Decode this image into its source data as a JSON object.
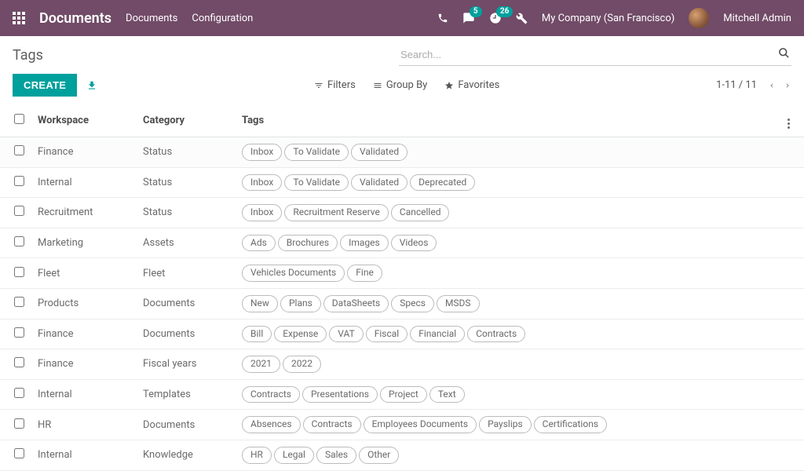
{
  "navbar": {
    "brand": "Documents",
    "links": [
      "Documents",
      "Configuration"
    ],
    "messages_badge": "5",
    "activities_badge": "26",
    "company": "My Company (San Francisco)",
    "username": "Mitchell Admin"
  },
  "breadcrumb": "Tags",
  "search": {
    "placeholder": "Search..."
  },
  "buttons": {
    "create": "CREATE",
    "filters": "Filters",
    "group_by": "Group By",
    "favorites": "Favorites"
  },
  "pager": "1-11 / 11",
  "table": {
    "headers": {
      "workspace": "Workspace",
      "category": "Category",
      "tags": "Tags"
    },
    "rows": [
      {
        "workspace": "Finance",
        "category": "Status",
        "tags": [
          "Inbox",
          "To Validate",
          "Validated"
        ]
      },
      {
        "workspace": "Internal",
        "category": "Status",
        "tags": [
          "Inbox",
          "To Validate",
          "Validated",
          "Deprecated"
        ]
      },
      {
        "workspace": "Recruitment",
        "category": "Status",
        "tags": [
          "Inbox",
          "Recruitment Reserve",
          "Cancelled"
        ]
      },
      {
        "workspace": "Marketing",
        "category": "Assets",
        "tags": [
          "Ads",
          "Brochures",
          "Images",
          "Videos"
        ]
      },
      {
        "workspace": "Fleet",
        "category": "Fleet",
        "tags": [
          "Vehicles Documents",
          "Fine"
        ]
      },
      {
        "workspace": "Products",
        "category": "Documents",
        "tags": [
          "New",
          "Plans",
          "DataSheets",
          "Specs",
          "MSDS"
        ]
      },
      {
        "workspace": "Finance",
        "category": "Documents",
        "tags": [
          "Bill",
          "Expense",
          "VAT",
          "Fiscal",
          "Financial",
          "Contracts"
        ]
      },
      {
        "workspace": "Finance",
        "category": "Fiscal years",
        "tags": [
          "2021",
          "2022"
        ]
      },
      {
        "workspace": "Internal",
        "category": "Templates",
        "tags": [
          "Contracts",
          "Presentations",
          "Project",
          "Text"
        ]
      },
      {
        "workspace": "HR",
        "category": "Documents",
        "tags": [
          "Absences",
          "Contracts",
          "Employees Documents",
          "Payslips",
          "Certifications"
        ]
      },
      {
        "workspace": "Internal",
        "category": "Knowledge",
        "tags": [
          "HR",
          "Legal",
          "Sales",
          "Other"
        ]
      }
    ]
  }
}
